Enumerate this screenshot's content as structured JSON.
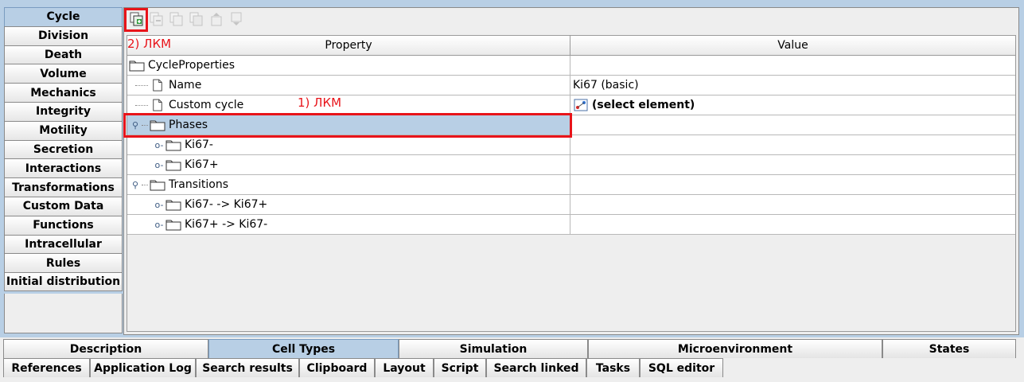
{
  "left_tabs": [
    "Cycle",
    "Division",
    "Death",
    "Volume",
    "Mechanics",
    "Integrity",
    "Motility",
    "Secretion",
    "Interactions",
    "Transformations",
    "Custom Data",
    "Functions",
    "Intracellular",
    "Rules",
    "Initial distribution"
  ],
  "toolbar": {
    "icons": [
      "add-element-icon",
      "remove-element-icon",
      "copy-element-icon",
      "duplicate-element-icon",
      "move-up-icon",
      "move-down-icon"
    ],
    "annotation": "2) ЛКМ"
  },
  "table": {
    "headers": {
      "property": "Property",
      "value": "Value"
    },
    "rows": [
      {
        "label": "CycleProperties",
        "value": "",
        "icon": "folder-icon"
      },
      {
        "label": "Name",
        "value": "Ki67 (basic)",
        "icon": "file-icon"
      },
      {
        "label": "Custom cycle",
        "value": "(select element)",
        "icon": "file-icon"
      },
      {
        "label": "Phases",
        "value": "",
        "icon": "folder-icon"
      },
      {
        "label": "Ki67-",
        "value": "",
        "icon": "folder-icon"
      },
      {
        "label": "Ki67+",
        "value": "",
        "icon": "folder-icon"
      },
      {
        "label": "Transitions",
        "value": "",
        "icon": "folder-icon"
      },
      {
        "label": "Ki67- -> Ki67+",
        "value": "",
        "icon": "folder-icon"
      },
      {
        "label": "Ki67+ -> Ki67-",
        "value": "",
        "icon": "folder-icon"
      }
    ],
    "annotation": "1) ЛКМ"
  },
  "bottom_tabs_row1": [
    "Description",
    "Cell Types",
    "Simulation",
    "Microenvironment",
    "States"
  ],
  "bottom_tabs_row2": [
    "References",
    "Application Log",
    "Search results",
    "Clipboard",
    "Layout",
    "Script",
    "Search linked",
    "Tasks",
    "SQL editor"
  ],
  "colors": {
    "selection": "#b8cfe5",
    "annotation": "#e8141a"
  }
}
